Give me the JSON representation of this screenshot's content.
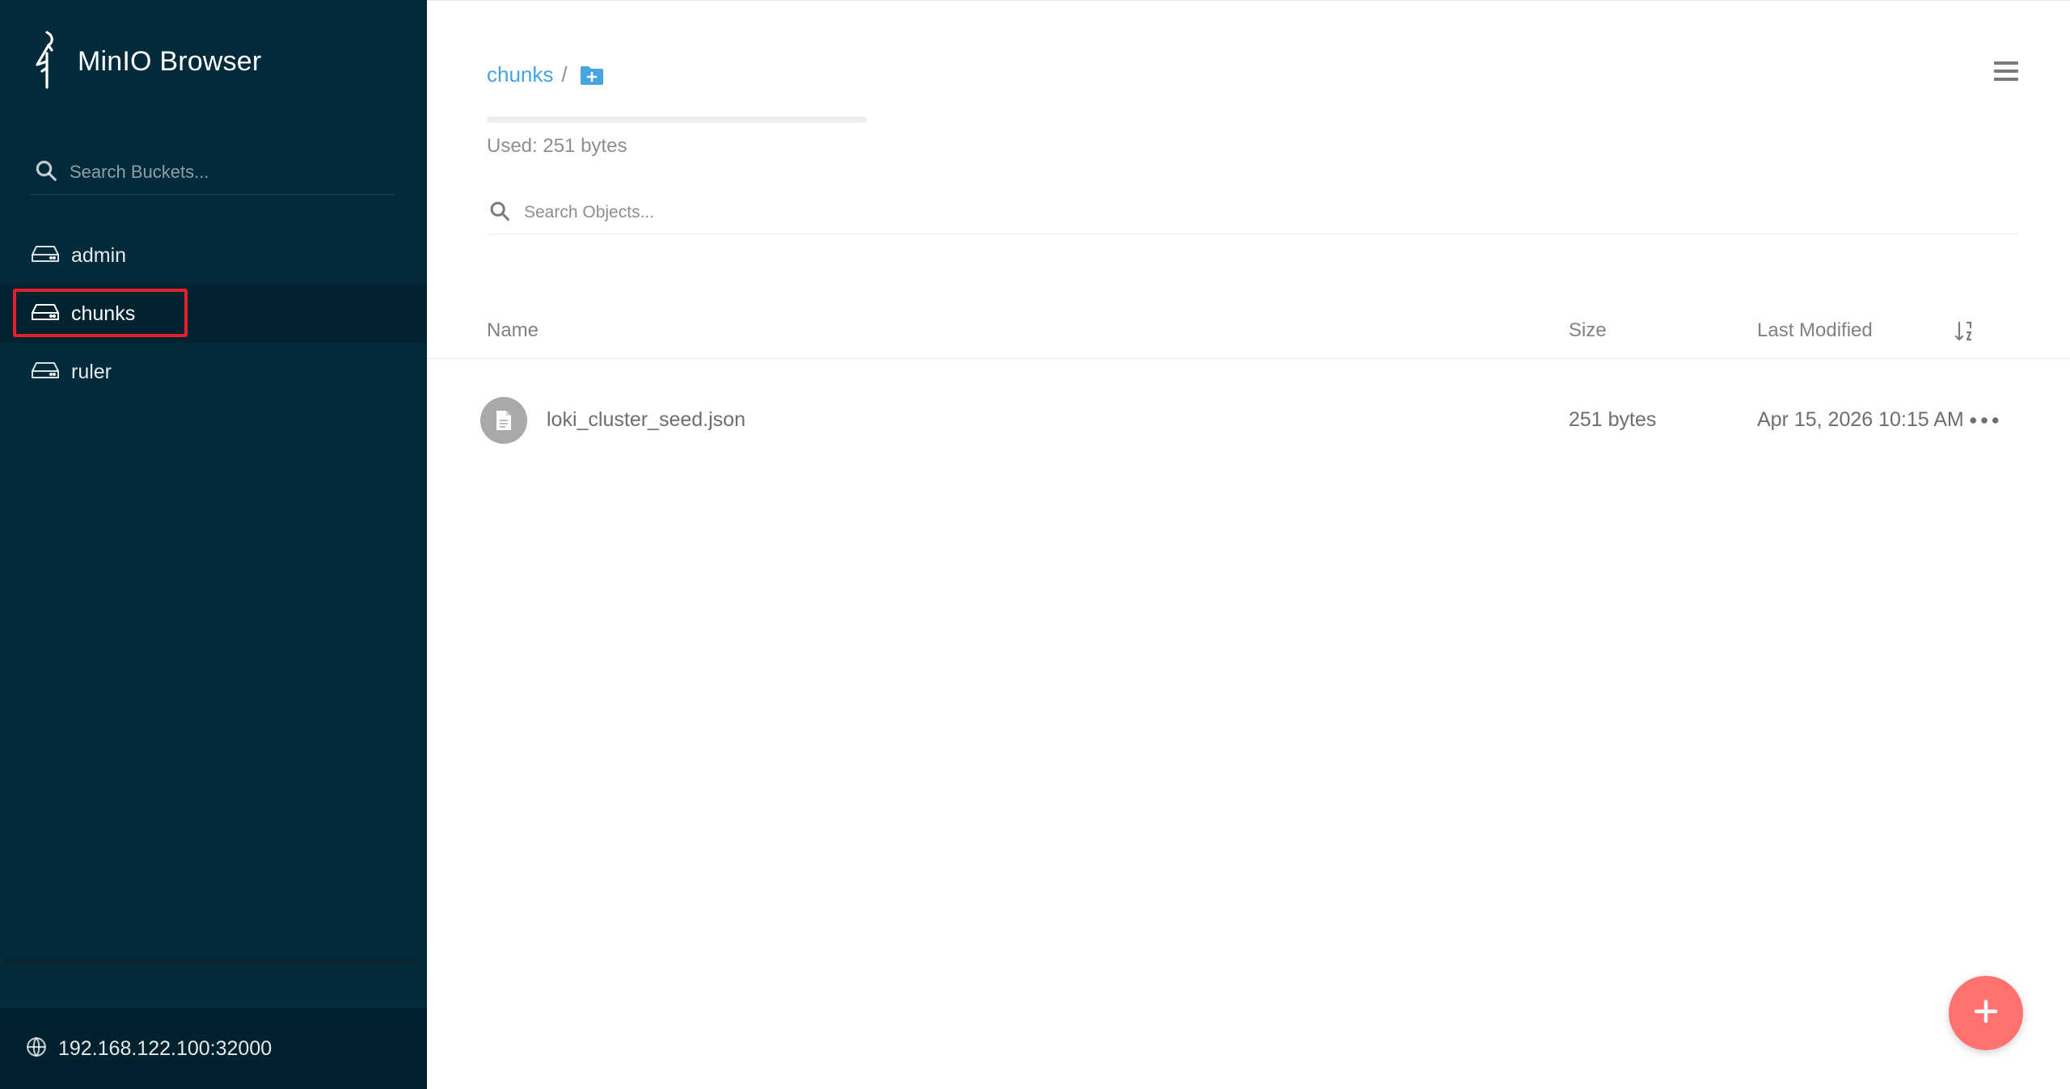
{
  "app": {
    "title": "MinIO Browser"
  },
  "sidebar": {
    "search_placeholder": "Search Buckets...",
    "buckets": [
      {
        "label": "admin",
        "active": false
      },
      {
        "label": "chunks",
        "active": true
      },
      {
        "label": "ruler",
        "active": false
      }
    ],
    "host": "192.168.122.100:32000"
  },
  "main": {
    "breadcrumb": {
      "bucket": "chunks",
      "separator": "/"
    },
    "usage": {
      "text": "Used: 251 bytes",
      "fraction": 0.0
    },
    "search_placeholder": "Search Objects...",
    "table": {
      "headers": {
        "name": "Name",
        "size": "Size",
        "modified": "Last Modified"
      },
      "rows": [
        {
          "name": "loki_cluster_seed.json",
          "size": "251 bytes",
          "modified": "Apr 15, 2026 10:15 AM"
        }
      ]
    }
  },
  "colors": {
    "sidebar_bg": "#012A3A",
    "link": "#46A5E0",
    "fab": "#FF726F",
    "highlight": "#E4202B"
  },
  "icons": {
    "logo": "minio-bird-icon",
    "bucket_search": "search-icon",
    "bucket": "hard-drive-icon",
    "host": "globe-icon",
    "new_folder": "folder-plus-icon",
    "menu": "hamburger-menu-icon",
    "object_search": "search-icon",
    "sort": "sort-icon",
    "file": "file-icon",
    "row_actions": "more-horizontal-icon",
    "fab": "plus-icon"
  }
}
